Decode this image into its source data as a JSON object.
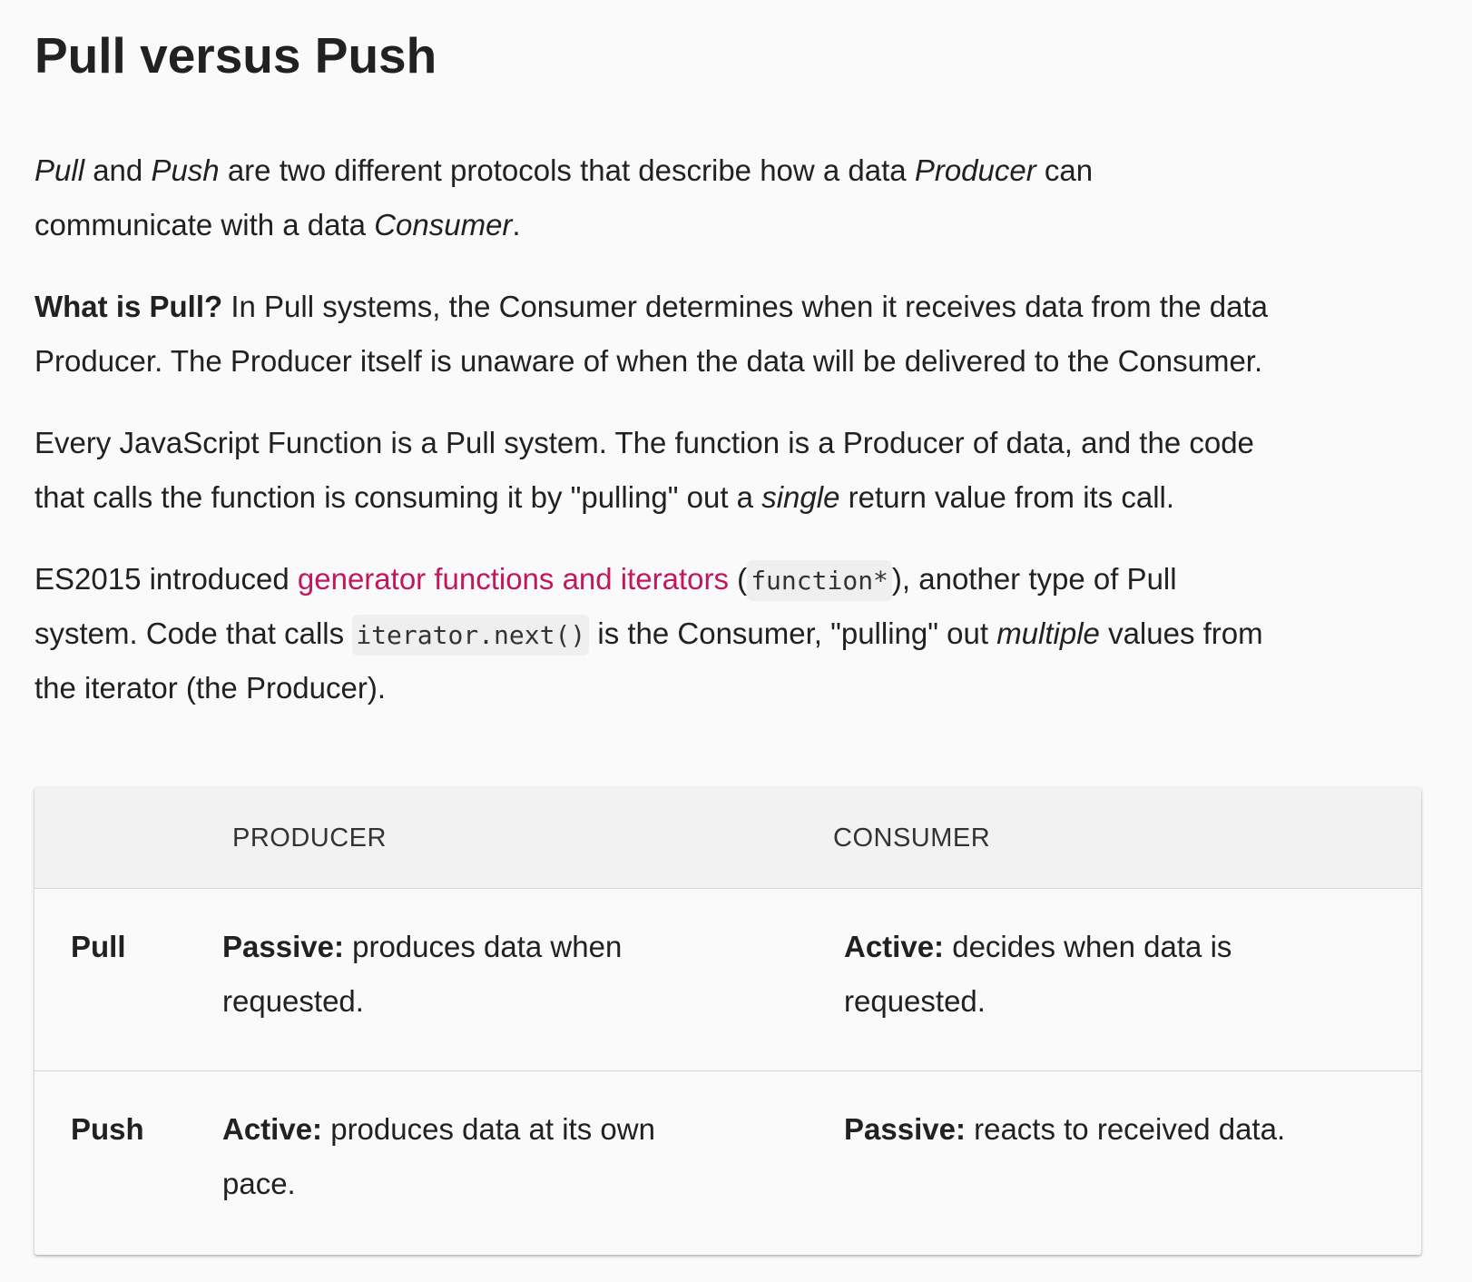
{
  "title": "Pull versus Push",
  "intro": {
    "pull_em": "Pull",
    "and": " and ",
    "push_em": "Push",
    "text1": " are two different protocols that describe how a data ",
    "producer_em": "Producer",
    "text2": " can",
    "text3": "communicate with a data ",
    "consumer_em": "Consumer",
    "text4": "."
  },
  "what_is_pull": {
    "bold": "What is Pull?",
    "line1": " In Pull systems, the Consumer determines when it receives data from the data",
    "line2": "Producer. The Producer itself is unaware of when the data will be delivered to the Consumer."
  },
  "js_function": {
    "line1": "Every JavaScript Function is a Pull system. The function is a Producer of data, and the code",
    "line2a": "that calls the function is consuming it by \"pulling\" out a ",
    "line2_em": "single",
    "line2b": " return value from its call."
  },
  "es2015": {
    "line1a": "ES2015 introduced ",
    "link": "generator functions and iterators",
    "line1b": " (",
    "code1": "function*",
    "line1c": "), another type of Pull",
    "line2a": "system. Code that calls ",
    "code2": "iterator.next()",
    "line2b": " is the Consumer, \"pulling\" out ",
    "line2_em": "multiple",
    "line2c": " values from",
    "line3": "the iterator (the Producer)."
  },
  "table": {
    "headers": {
      "producer": "PRODUCER",
      "consumer": "CONSUMER"
    },
    "rows": [
      {
        "label": "Pull",
        "producer_bold": "Passive:",
        "producer_line1": " produces data when",
        "producer_line2": "requested.",
        "consumer_bold": "Active:",
        "consumer_line1": " decides when data is",
        "consumer_line2": "requested."
      },
      {
        "label": "Push",
        "producer_bold": "Active:",
        "producer_line1": " produces data at its own",
        "producer_line2": "pace.",
        "consumer_bold": "Passive:",
        "consumer_line1": " reacts to received data.",
        "consumer_line2": ""
      }
    ]
  },
  "colors": {
    "text": "#212121",
    "link": "#c2185b",
    "background": "#fafafa",
    "table_header_bg": "#f2f2f2",
    "code_bg": "#efefef"
  }
}
